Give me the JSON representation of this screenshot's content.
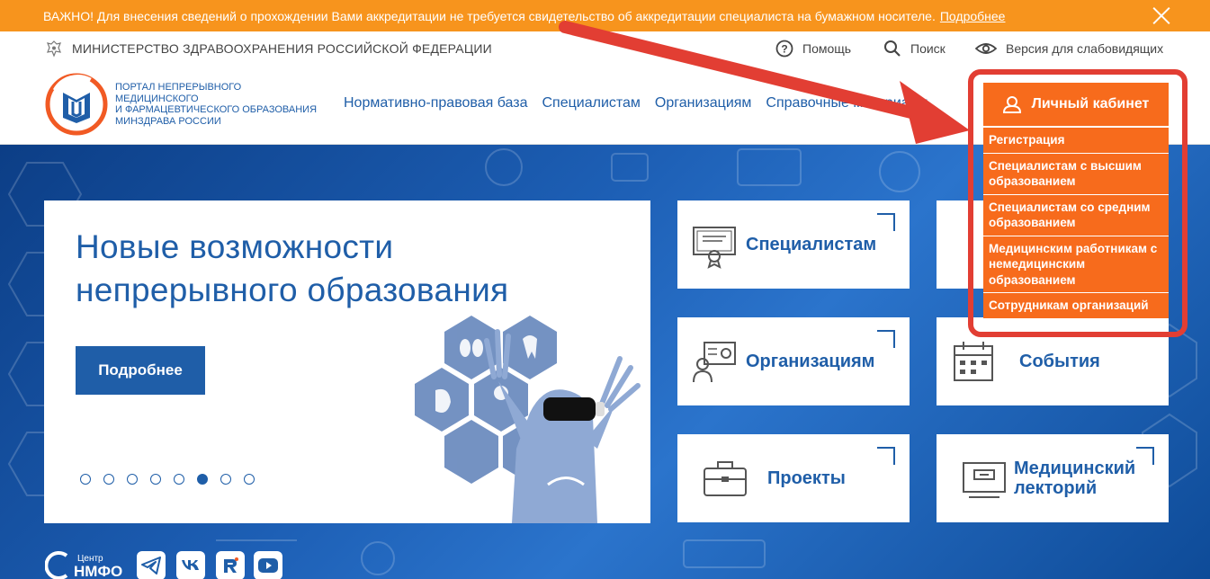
{
  "notice": {
    "text": "ВАЖНО! Для внесения сведений о прохождении Вами аккредитации не требуется свидетельство об аккредитации специалиста на бумажном носителе.",
    "link": "Подробнее"
  },
  "util": {
    "ministry": "МИНИСТЕРСТВО ЗДРАВООХРАНЕНИЯ РОССИЙСКОЙ ФЕДЕРАЦИИ",
    "help": "Помощь",
    "search": "Поиск",
    "accessibility": "Версия для слабовидящих"
  },
  "logo": {
    "line1": "ПОРТАЛ НЕПРЕРЫВНОГО",
    "line2": "МЕДИЦИНСКОГО",
    "line3": "И ФАРМАЦЕВТИЧЕСКОГО ОБРАЗОВАНИЯ",
    "line4": "МИНЗДРАВА РОССИИ"
  },
  "nav": [
    "Нормативно-правовая база",
    "Специалистам",
    "Организациям",
    "Справочные материалы"
  ],
  "slide": {
    "title_line1": "Новые возможности",
    "title_line2": "непрерывного образования",
    "button": "Подробнее",
    "dots": 8,
    "active_dot": 6
  },
  "cards": {
    "specialists": "Специалистам",
    "organizations": "Организациям",
    "events": "События",
    "projects": "Проекты",
    "lectures_1": "Медицинский",
    "lectures_2": "лекторий"
  },
  "social": {
    "nmfo_small": "Центр",
    "nmfo_big": "НМФО"
  },
  "cabinet": {
    "button": "Личный кабинет",
    "menu": [
      "Регистрация",
      "Специалистам с высшим образованием",
      "Специалистам со средним образованием",
      "Медицинским работникам с немедицинским образованием",
      "Сотрудникам организаций"
    ]
  },
  "colors": {
    "brand_blue": "#1f5ea8",
    "orange": "#f76b1c",
    "notice_orange": "#f7941d",
    "highlight_red": "#e23e33"
  }
}
